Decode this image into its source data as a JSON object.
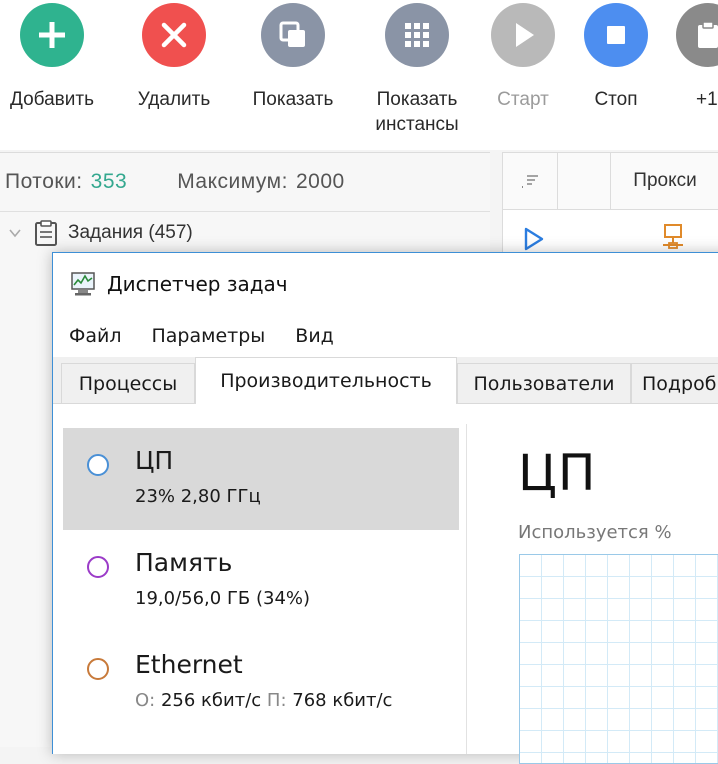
{
  "toolbar": {
    "buttons": [
      {
        "label": "Добавить",
        "icon": "plus-icon",
        "color": "#2fb38f"
      },
      {
        "label": "Удалить",
        "icon": "close-icon",
        "color": "#f0504f"
      },
      {
        "label": "Показать",
        "icon": "copy-icon",
        "color": "#8a94a6"
      },
      {
        "label": "Показать\nинстансы",
        "icon": "grid-icon",
        "color": "#8a94a6"
      },
      {
        "label": "Старт",
        "icon": "play-icon",
        "color": "#b9b9b9"
      },
      {
        "label": "Стоп",
        "icon": "stop-icon",
        "color": "#4d8ef0"
      },
      {
        "label": "+1",
        "icon": "clipboard-icon",
        "color": "#8a8a8a"
      }
    ]
  },
  "threads": {
    "label": "Потоки:",
    "value": "353",
    "max_label": "Максимум:",
    "max_value": "2000"
  },
  "tasks": {
    "label": "Задания (457)"
  },
  "table": {
    "proxy_header": "Прокси"
  },
  "task_manager": {
    "title": "Диспетчер задач",
    "menu": [
      "Файл",
      "Параметры",
      "Вид"
    ],
    "tabs": [
      "Процессы",
      "Производительность",
      "Пользователи",
      "Подробности"
    ],
    "active_tab": "Производительность",
    "resources": [
      {
        "name": "ЦП",
        "detail": "23% 2,80 ГГц",
        "ring_color": "#4a90d6",
        "selected": true
      },
      {
        "name": "Память",
        "detail": "19,0/56,0 ГБ (34%)",
        "ring_color": "#9b3bc8",
        "selected": false
      },
      {
        "name": "Ethernet",
        "detail_send_label": "О:",
        "detail_send": "256 кбит/с",
        "detail_recv_label": "П:",
        "detail_recv": "768 кбит/с",
        "ring_color": "#c87a3a",
        "selected": false
      }
    ],
    "heading": "ЦП",
    "usage_label": "Используется %"
  },
  "colors": {
    "threads_value": "#34a88f",
    "window_border": "#3d8fd6",
    "graph_grid": "#d3eaf7"
  }
}
